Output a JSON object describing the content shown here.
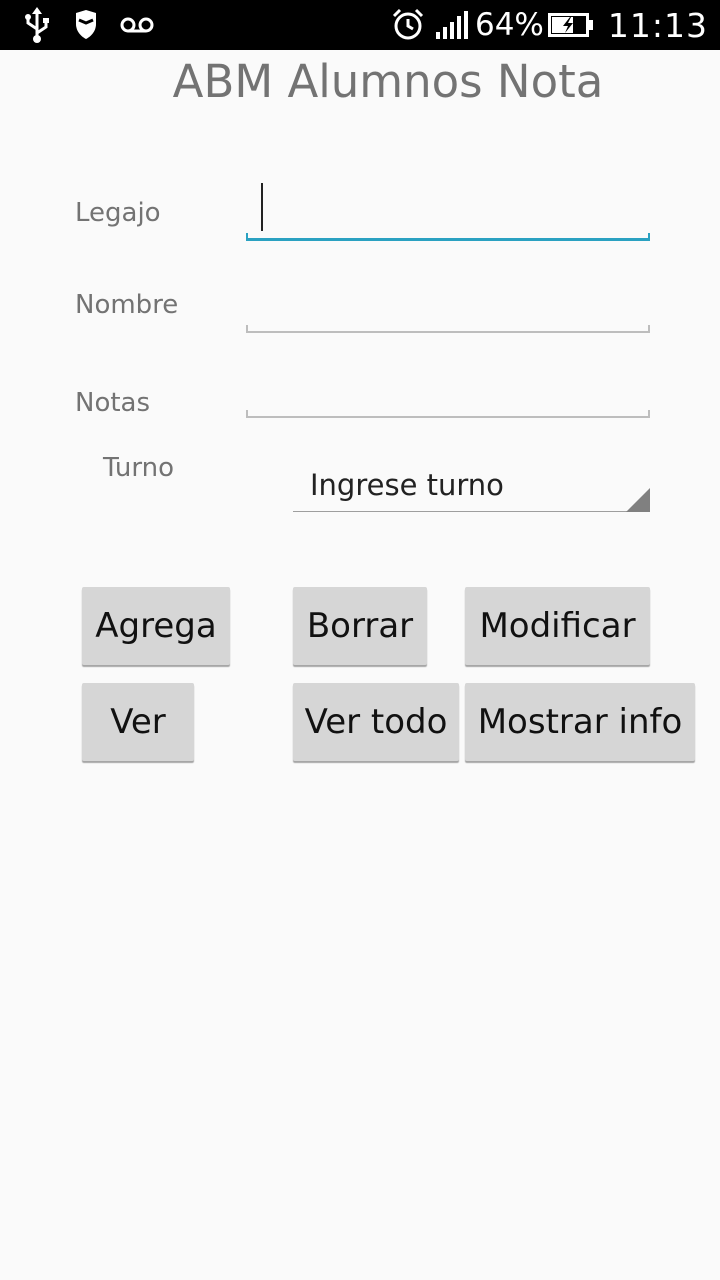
{
  "status_bar": {
    "left_icons": [
      "usb-icon",
      "shield-icon",
      "voicemail-icon"
    ],
    "right_icons": [
      "alarm-icon",
      "signal-icon",
      "battery-charging-icon"
    ],
    "battery_percent": "64%",
    "time": "11:13",
    "battery_level": 0.64
  },
  "title": "ABM Alumnos Nota",
  "form": {
    "legajo_label": "Legajo",
    "legajo_value": "",
    "nombre_label": "Nombre",
    "nombre_value": "",
    "notas_label": "Notas",
    "notas_value": "",
    "turno_label": "Turno",
    "turno_selected": "Ingrese turno"
  },
  "buttons": {
    "agrega": "Agrega",
    "borrar": "Borrar",
    "modificar": "Modificar",
    "ver": "Ver",
    "ver_todo": "Ver todo",
    "mostrar_info": "Mostrar info"
  },
  "colors": {
    "focus_accent": "#2aa1c1",
    "button_bg": "#d6d6d6",
    "label_text": "#737373"
  }
}
